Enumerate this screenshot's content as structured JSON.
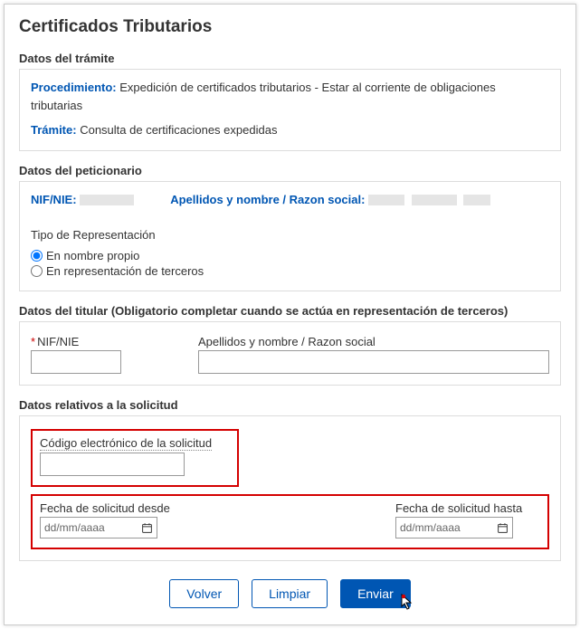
{
  "page_title": "Certificados Tributarios",
  "tramite": {
    "section_title": "Datos del trámite",
    "procedimiento_label": "Procedimiento:",
    "procedimiento_value": "Expedición de certificados tributarios - Estar al corriente de obligaciones tributarias",
    "tramite_label": "Trámite:",
    "tramite_value": "Consulta de certificaciones expedidas"
  },
  "peticionario": {
    "section_title": "Datos del peticionario",
    "nif_label": "NIF/NIE:",
    "apellidos_label": "Apellidos y nombre / Razon social:",
    "tipo_rep_label": "Tipo de Representación",
    "rep_propio": "En nombre propio",
    "rep_terceros": "En representación de terceros"
  },
  "titular": {
    "section_title": "Datos del titular (Obligatorio completar cuando se actúa en representación de terceros)",
    "nif_label": "NIF/NIE",
    "apellidos_label": "Apellidos y nombre / Razon social",
    "nif_value": "",
    "apellidos_value": ""
  },
  "solicitud": {
    "section_title": "Datos relativos a la solicitud",
    "codigo_label": "Código electrónico de la solicitud",
    "codigo_value": "",
    "fecha_desde_label": "Fecha de solicitud desde",
    "fecha_hasta_label": "Fecha de solicitud hasta",
    "fecha_placeholder": "dd/mm/aaaa"
  },
  "buttons": {
    "volver": "Volver",
    "limpiar": "Limpiar",
    "enviar": "Enviar"
  }
}
